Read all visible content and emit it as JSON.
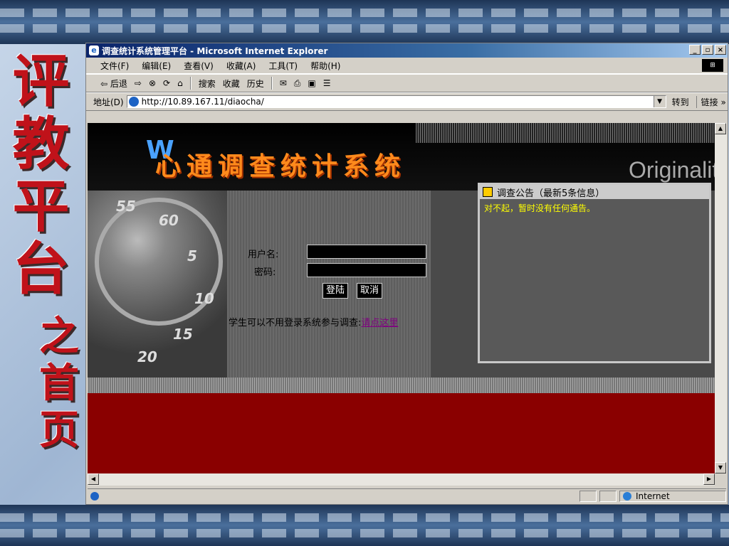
{
  "slide": {
    "side_title": "评教平台",
    "side_subtitle": "之首页"
  },
  "window": {
    "title": "调查统计系统管理平台 - Microsoft Internet Explorer",
    "minimize": "_",
    "maximize": "▫",
    "close": "×"
  },
  "menu": [
    "文件(F)",
    "编辑(E)",
    "查看(V)",
    "收藏(A)",
    "工具(T)",
    "帮助(H)"
  ],
  "toolbar": {
    "back": "⇦ 后退",
    "forward": "⇨",
    "stop": "⊗",
    "refresh": "⟳",
    "home": "⌂",
    "search": "搜索",
    "favorites": "收藏",
    "history": "历史"
  },
  "address": {
    "label": "地址(D)",
    "url": "http://10.89.167.11/diaocha/",
    "go": "转到",
    "links": "链接 »"
  },
  "page": {
    "brand": "心通调查统计系统",
    "deco_text": "Originalit",
    "username_label": "用户名:",
    "password_label": "密码:",
    "login_button": "登陆",
    "cancel_button": "取消",
    "note": "学生可以不用登录系统参与调查:",
    "note_link": "请点这里",
    "dial_numbers": [
      "55",
      "60",
      "5",
      "10",
      "15",
      "20"
    ]
  },
  "notice": {
    "title": "调查公告（最新5条信息）",
    "body": "对不起，暂时没有任何通告。"
  },
  "status": {
    "zone": "Internet"
  }
}
